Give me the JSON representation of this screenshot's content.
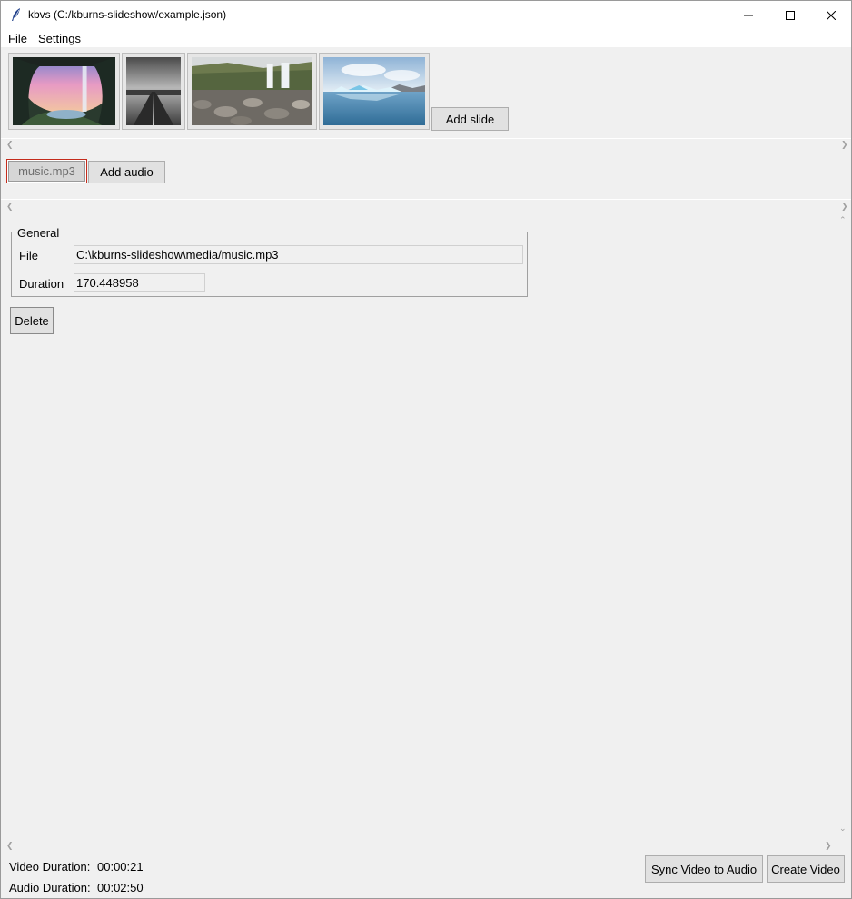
{
  "window": {
    "title": "kbvs (C:/kburns-slideshow/example.json)"
  },
  "menu": {
    "file": "File",
    "settings": "Settings"
  },
  "slides": {
    "items": [
      {
        "name": "waterfall cave"
      },
      {
        "name": "road"
      },
      {
        "name": "waterfall rocks"
      },
      {
        "name": "glacier lagoon"
      }
    ],
    "add_label": "Add slide"
  },
  "audio": {
    "items": [
      {
        "label": "music.mp3"
      }
    ],
    "add_label": "Add audio"
  },
  "general": {
    "legend": "General",
    "file_label": "File",
    "file_value": "C:\\kburns-slideshow\\media/music.mp3",
    "duration_label": "Duration",
    "duration_value": "170.448958",
    "delete_label": "Delete"
  },
  "status": {
    "video_label": "Video Duration:",
    "video_value": "00:00:21",
    "audio_label": "Audio Duration:",
    "audio_value": "00:02:50"
  },
  "actions": {
    "sync_label": "Sync Video to Audio",
    "create_label": "Create Video"
  }
}
